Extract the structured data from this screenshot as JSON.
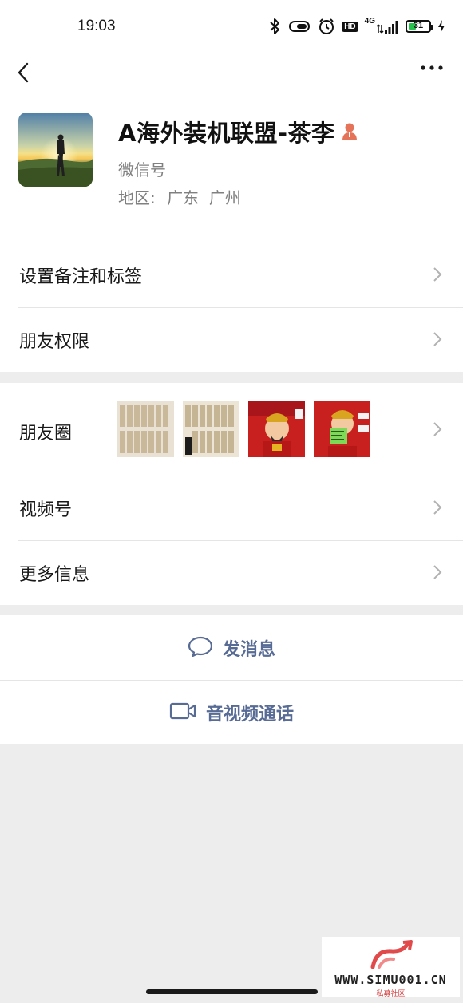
{
  "status_bar": {
    "time": "19:03",
    "network": "4G",
    "hd_badge": "HD",
    "battery_level": "31"
  },
  "profile": {
    "name": "A海外装机联盟-茶李",
    "wechat_id_label": "微信号",
    "region_label": "地区:",
    "region_value": "广东  广州"
  },
  "menu": {
    "remark_tags": "设置备注和标签",
    "friend_permissions": "朋友权限",
    "moments": "朋友圈",
    "channels": "视频号",
    "more_info": "更多信息"
  },
  "actions": {
    "send_message": "发消息",
    "video_call": "音视频通话"
  },
  "watermark": {
    "site": "WWW.SIMU001.CN",
    "subtitle": "私募社区"
  },
  "colors": {
    "link_blue": "#576b95",
    "background": "#ededed",
    "battery_green": "#27c24c",
    "gender_female": "#e5735a"
  }
}
